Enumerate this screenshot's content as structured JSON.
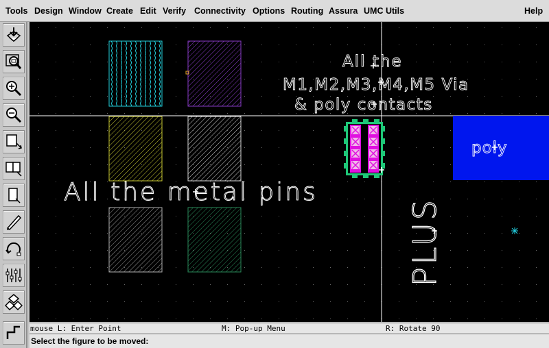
{
  "menus": [
    "Tools",
    "Design",
    "Window",
    "Create",
    "Edit",
    "Verify",
    "Connectivity",
    "Options",
    "Routing",
    "Assura",
    "UMC Utils",
    "Help"
  ],
  "toolbar": {
    "tools": [
      "save-icon",
      "zoom-fit-icon",
      "zoom-in-icon",
      "zoom-out-icon",
      "stretch-icon",
      "copy-icon",
      "move-icon",
      "delete-icon",
      "undo-icon",
      "properties-icon",
      "hierarchy-icon",
      "path-icon"
    ]
  },
  "canvas": {
    "labels": {
      "pins_label": "All the metal pins",
      "via_line1": "All the",
      "via_line2": "M1,M2,M3,M4,M5 Via",
      "via_line3": "& poly contacts",
      "poly_label": "poly",
      "plus_label": "PLUS"
    },
    "colors": {
      "background": "#000000",
      "poly_fill": "#0016ee",
      "contact_magenta": "#e010e0",
      "contact_pink": "#f0b8e8",
      "via_green": "#1ec878",
      "grid_dot": "#6a6a6a",
      "cursor_cyan": "#22ccdd"
    }
  },
  "status": {
    "left": "mouse L: Enter Point",
    "middle": "M: Pop-up Menu",
    "right": "R: Rotate 90"
  },
  "prompt": "Select the figure to be moved:"
}
